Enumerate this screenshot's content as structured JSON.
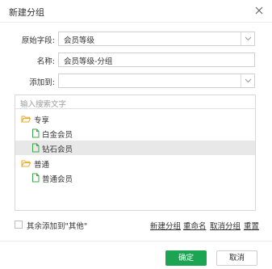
{
  "dialog": {
    "title": "新建分组"
  },
  "form": {
    "source_field": {
      "label": "原始字段:",
      "value": "会员等级"
    },
    "name": {
      "label": "名称:",
      "value": "会员等级-分组"
    },
    "add_to": {
      "label": "添加到:",
      "value": ""
    }
  },
  "tree": {
    "search_placeholder": "输入搜索文字",
    "groups": [
      {
        "label": "专享",
        "icon": "folder-open-icon",
        "children": [
          "白金会员",
          "钻石会员"
        ]
      },
      {
        "label": "普通",
        "icon": "folder-open-icon",
        "children": [
          "普通会员"
        ]
      }
    ],
    "selected_item": "钻石会员"
  },
  "footer": {
    "others_checkbox_label": "其余添加到\"其他\"",
    "others_checked": false,
    "actions": [
      "新建分组",
      "重命名",
      "取消分组",
      "重置"
    ]
  },
  "buttons": {
    "ok": "确定",
    "cancel": "取消"
  },
  "colors": {
    "primary": "#1ba552",
    "folder": "#f0a92b",
    "file": "#3aa845",
    "selected_row": "#e8e8e8"
  }
}
